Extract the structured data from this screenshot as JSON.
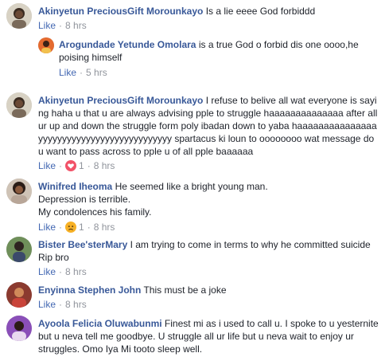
{
  "comments": [
    {
      "name": "Akinyetun PreciousGift Moroun kayo",
      "name_display": "Akinyetun PreciousGift Moroun​kayo",
      "text": " Is a lie eeee God forbiddd",
      "like": "Like",
      "time": "8 hrs"
    },
    {
      "name": "Arogundade Yetunde Omolara",
      "text": " is a true God o forbid dis one oooo,he poising himself",
      "like": "Like",
      "time": "5 hrs"
    },
    {
      "name": "Akinyetun PreciousGift Morounkayo",
      "text": " I refuse to belive all wat everyone is saying haha u that u are always advising pple to struggle haaaaaaaaaaaaaa after all ur up and down the struggle form poly ibadan down to yaba haaaaaaaaaaaaaaa yyyyyyyyyyyyyyyyyyyyyyyyyyyy spartacus ki loun to oooooooo wat message do u want to pass across to pple u of all pple baaaaaa",
      "like": "Like",
      "reaction_count": "1",
      "time": "8 hrs"
    },
    {
      "name": "Winifred Iheoma",
      "text_lines": [
        " He seemed like a bright young man.",
        "Depression is terrible.",
        "My condolences his family."
      ],
      "like": "Like",
      "reaction_count": "1",
      "time": "8 hrs"
    },
    {
      "name": "Bister Bee'sterMary",
      "text": " I am trying to come in terms to why he committed suicide",
      "text2": "Rip bro",
      "like": "Like",
      "time": "8 hrs"
    },
    {
      "name": "Enyinna Stephen John",
      "text": " This must be a joke",
      "like": "Like",
      "time": "8 hrs"
    },
    {
      "name": "Ayoola Felicia Oluwabunmi",
      "text": " Finest mi as i used to call u. I spoke to u yesternite but u neva tell me goodbye. U struggle all ur life but u neva wait to enjoy ur struggles. Omo Iya Mi tooto sleep well."
    }
  ],
  "separator": "·",
  "colors": {
    "name": "#385898",
    "link": "#4267b2",
    "meta": "#90949c",
    "text": "#1d2129",
    "love": "#f25268",
    "sad": "#f7b125"
  },
  "icons": {
    "love": "heart-reaction-icon",
    "sad": "sad-reaction-icon"
  }
}
